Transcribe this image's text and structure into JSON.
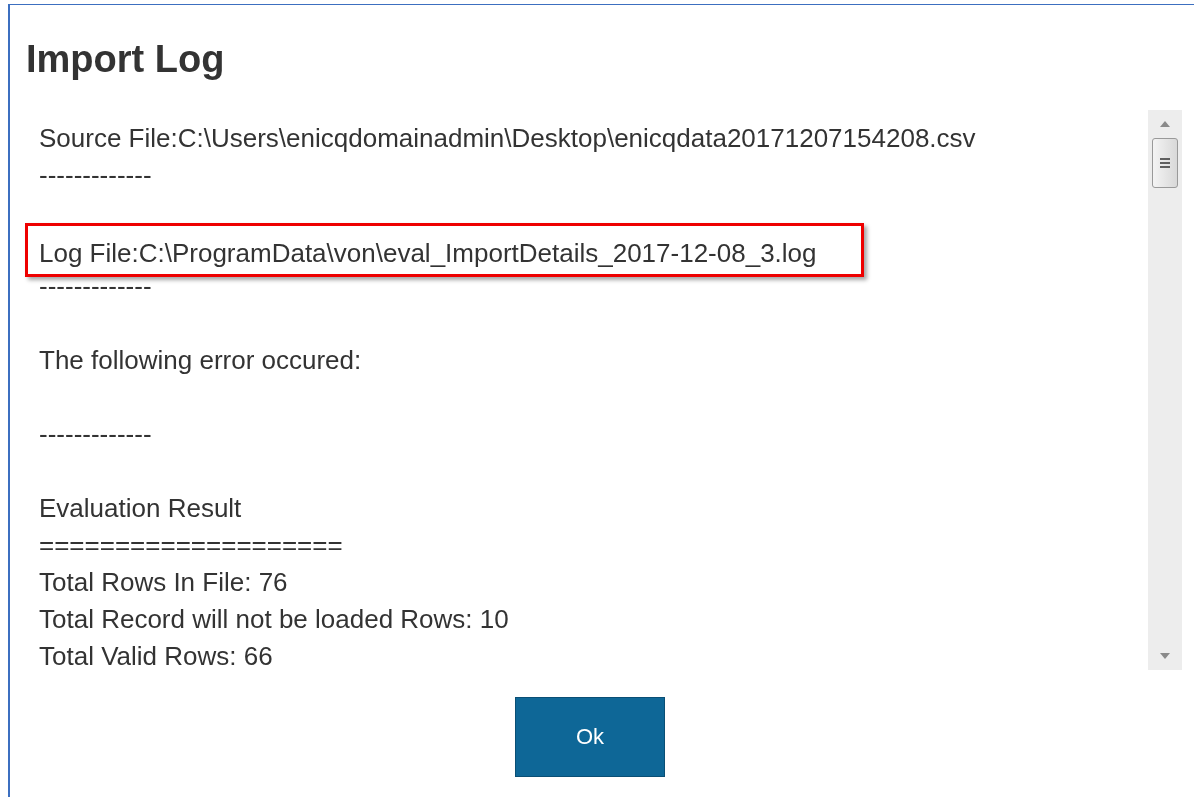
{
  "dialog": {
    "title": "Import Log"
  },
  "log_blocks": [
    {
      "lines": [
        {
          "text": "Source File:C:\\Users\\enicqdomainadmin\\Desktop\\enicqdata20171207154208.csv",
          "highlighted": false
        },
        {
          "text": "-------------",
          "highlighted": false
        }
      ]
    },
    {
      "lines": [
        {
          "text": "Log File:C:\\ProgramData\\von\\eval_ImportDetails_2017-12-08_3.log",
          "highlighted": true
        },
        {
          "text": "-------------",
          "highlighted": false
        }
      ]
    },
    {
      "lines": [
        {
          "text": "The following error occured:",
          "highlighted": false
        }
      ]
    },
    {
      "lines": [
        {
          "text": "-------------",
          "highlighted": false
        }
      ]
    },
    {
      "lines": [
        {
          "text": "Evaluation Result",
          "highlighted": false
        },
        {
          "text": "====================",
          "highlighted": false
        },
        {
          "text": "Total Rows In File: 76",
          "highlighted": false
        },
        {
          "text": "Total Record will not be loaded Rows: 10",
          "highlighted": false
        },
        {
          "text": "Total Valid Rows: 66",
          "highlighted": false
        }
      ]
    }
  ],
  "buttons": [
    {
      "label": "Ok"
    }
  ]
}
